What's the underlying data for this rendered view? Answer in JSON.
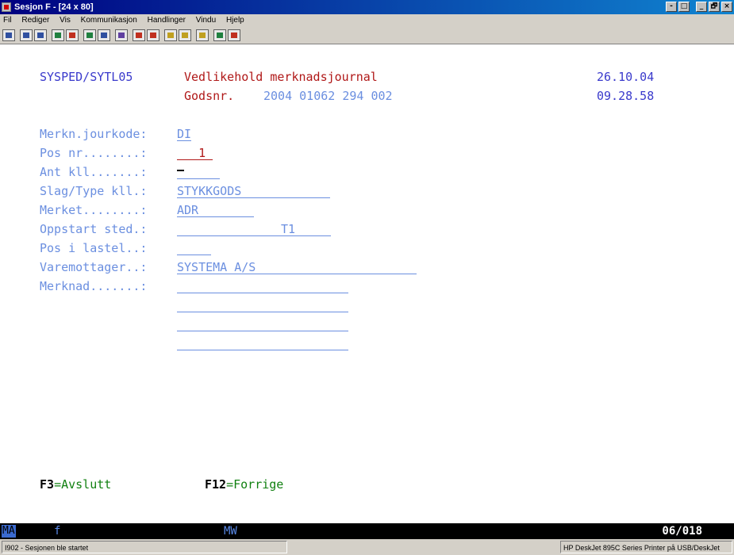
{
  "window": {
    "title": "Sesjon F - [24 x 80]",
    "controls": [
      "-",
      "□",
      "_",
      "🗗",
      "×"
    ]
  },
  "menu": [
    "Fil",
    "Rediger",
    "Vis",
    "Kommunikasjon",
    "Handlinger",
    "Vindu",
    "Hjelp"
  ],
  "toolbar_icons": [
    "print-screen-icon",
    "copy-icon",
    "paste-icon",
    "send-icon",
    "receive-icon",
    "display-icon",
    "keyboard-icon",
    "macro-icon",
    "record-macro-icon",
    "stop-macro-icon",
    "play-macro-icon",
    "transfer-icon",
    "clipboard-icon",
    "color-icon",
    "customize-icon"
  ],
  "screen": {
    "program_id": "SYSPED/SYTL05",
    "title": "Vedlikehold merknadsjournal",
    "date": "26.10.04",
    "godsnr_label": "Godsnr.",
    "godsnr_value": "2004 01062 294 002",
    "time": "09.28.58",
    "fields": [
      {
        "label": "Merkn.jourkode:",
        "value": "DI"
      },
      {
        "label": "Pos nr........:",
        "value": "   1"
      },
      {
        "label": "Ant kll.......:",
        "value": ""
      },
      {
        "label": "Slag/Type kll.:",
        "value": "STYKKGODS"
      },
      {
        "label": "Merket........:",
        "value": "ADR"
      },
      {
        "label": "Oppstart sted.:",
        "value": "",
        "value2": "T1"
      },
      {
        "label": "Pos i lastel..:",
        "value": ""
      },
      {
        "label": "Varemottager..:",
        "value": "SYSTEMA A/S"
      },
      {
        "label": "Merknad.......:",
        "value": ""
      }
    ],
    "fkeys": [
      {
        "key": "F3",
        "text": "=Avslutt"
      },
      {
        "key": "F12",
        "text": "=Forrige"
      }
    ]
  },
  "status_line": {
    "mode": "MA",
    "indicator": "f",
    "mw": "MW",
    "cursor_pos": "06/018"
  },
  "win_status": {
    "message": "I902 - Sesjonen ble startet",
    "printer": "HP DeskJet 895C Series Printer på USB/DeskJet"
  }
}
